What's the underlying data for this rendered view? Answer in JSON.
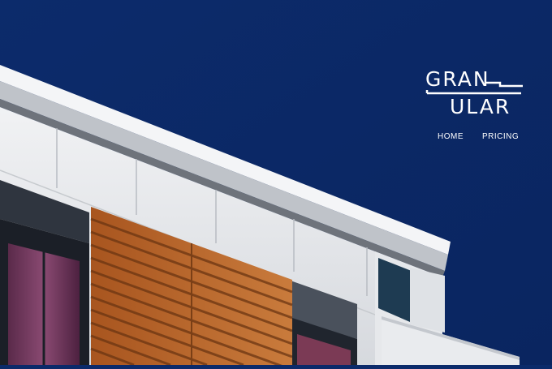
{
  "brand": {
    "logo_line1": "GRAN",
    "logo_line2": "ULAR"
  },
  "nav": {
    "items": [
      {
        "label": "HOME"
      },
      {
        "label": "PRICING"
      }
    ]
  },
  "colors": {
    "sky": "#0b2a6a",
    "wall": "#e7e9ec",
    "louver": "#b8642a",
    "logo": "#ffffff"
  }
}
